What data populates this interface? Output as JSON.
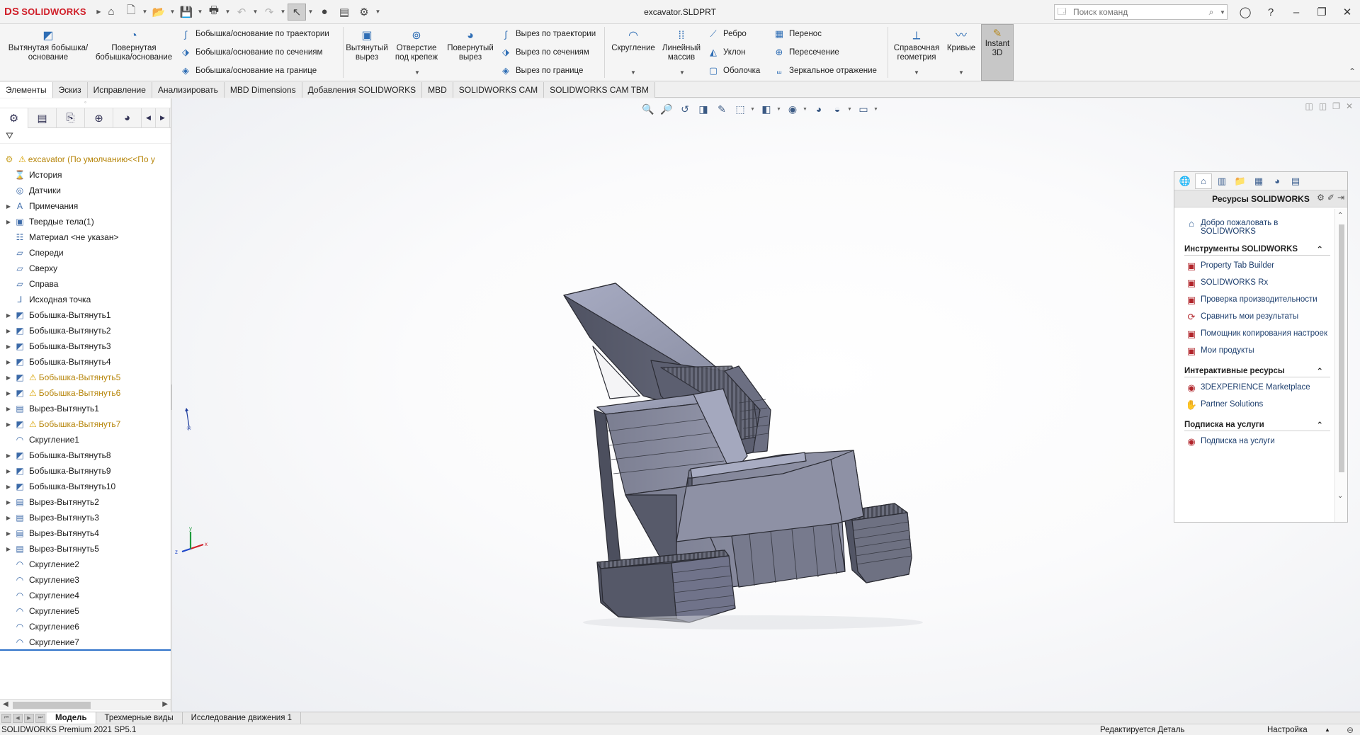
{
  "app": {
    "logo_brand": "SOLIDWORKS",
    "logo_mark": "DS",
    "doc_title": "excavator.SLDPRT"
  },
  "search": {
    "placeholder": "Поиск команд"
  },
  "ribbon": {
    "extrude_boss": "Вытянутая бобышка/основание",
    "revolve_boss": "Повернутая бобышка/основание",
    "sweep_boss": "Бобышка/основание по траектории",
    "loft_boss": "Бобышка/основание по сечениям",
    "boundary_boss": "Бобышка/основание на границе",
    "extrude_cut": "Вытянутый вырез",
    "hole_wizard": "Отверстие под крепеж",
    "revolve_cut": "Повернутый вырез",
    "sweep_cut": "Вырез по траектории",
    "loft_cut": "Вырез по сечениям",
    "boundary_cut": "Вырез по границе",
    "fillet": "Скругление",
    "linear_pattern": "Линейный массив",
    "rib": "Ребро",
    "draft": "Уклон",
    "shell": "Оболочка",
    "wrap": "Перенос",
    "intersect": "Пересечение",
    "mirror": "Зеркальное отражение",
    "ref_geometry": "Справочная геометрия",
    "curves": "Кривые",
    "instant3d": "Instant 3D"
  },
  "tabs": [
    "Элементы",
    "Эскиз",
    "Исправление",
    "Анализировать",
    "MBD Dimensions",
    "Добавления SOLIDWORKS",
    "MBD",
    "SOLIDWORKS CAM",
    "SOLIDWORKS CAM TBM"
  ],
  "tree": {
    "root": "excavator  (По умолчанию<<По у",
    "items": [
      {
        "label": "История",
        "icon": "history-icon",
        "exp": false,
        "warn": false
      },
      {
        "label": "Датчики",
        "icon": "sensor-icon",
        "exp": false,
        "warn": false
      },
      {
        "label": "Примечания",
        "icon": "annotation-icon",
        "exp": true,
        "warn": false
      },
      {
        "label": "Твердые тела(1)",
        "icon": "solid-bodies-icon",
        "exp": true,
        "warn": false
      },
      {
        "label": "Материал <не указан>",
        "icon": "material-icon",
        "exp": false,
        "warn": false
      },
      {
        "label": "Спереди",
        "icon": "plane-icon",
        "exp": false,
        "warn": false
      },
      {
        "label": "Сверху",
        "icon": "plane-icon",
        "exp": false,
        "warn": false
      },
      {
        "label": "Справа",
        "icon": "plane-icon",
        "exp": false,
        "warn": false
      },
      {
        "label": "Исходная точка",
        "icon": "origin-icon",
        "exp": false,
        "warn": false
      },
      {
        "label": "Бобышка-Вытянуть1",
        "icon": "extrude-icon",
        "exp": true,
        "warn": false
      },
      {
        "label": "Бобышка-Вытянуть2",
        "icon": "extrude-icon",
        "exp": true,
        "warn": false
      },
      {
        "label": "Бобышка-Вытянуть3",
        "icon": "extrude-icon",
        "exp": true,
        "warn": false
      },
      {
        "label": "Бобышка-Вытянуть4",
        "icon": "extrude-icon",
        "exp": true,
        "warn": false
      },
      {
        "label": "Бобышка-Вытянуть5",
        "icon": "extrude-icon",
        "exp": true,
        "warn": true
      },
      {
        "label": "Бобышка-Вытянуть6",
        "icon": "extrude-icon",
        "exp": true,
        "warn": true
      },
      {
        "label": "Вырез-Вытянуть1",
        "icon": "cut-icon",
        "exp": true,
        "warn": false
      },
      {
        "label": "Бобышка-Вытянуть7",
        "icon": "extrude-icon",
        "exp": true,
        "warn": true
      },
      {
        "label": "Скругление1",
        "icon": "fillet-icon",
        "exp": false,
        "warn": false
      },
      {
        "label": "Бобышка-Вытянуть8",
        "icon": "extrude-icon",
        "exp": true,
        "warn": false
      },
      {
        "label": "Бобышка-Вытянуть9",
        "icon": "extrude-icon",
        "exp": true,
        "warn": false
      },
      {
        "label": "Бобышка-Вытянуть10",
        "icon": "extrude-icon",
        "exp": true,
        "warn": false
      },
      {
        "label": "Вырез-Вытянуть2",
        "icon": "cut-icon",
        "exp": true,
        "warn": false
      },
      {
        "label": "Вырез-Вытянуть3",
        "icon": "cut-icon",
        "exp": true,
        "warn": false
      },
      {
        "label": "Вырез-Вытянуть4",
        "icon": "cut-icon",
        "exp": true,
        "warn": false
      },
      {
        "label": "Вырез-Вытянуть5",
        "icon": "cut-icon",
        "exp": true,
        "warn": false
      },
      {
        "label": "Скругление2",
        "icon": "fillet-icon",
        "exp": false,
        "warn": false
      },
      {
        "label": "Скругление3",
        "icon": "fillet-icon",
        "exp": false,
        "warn": false
      },
      {
        "label": "Скругление4",
        "icon": "fillet-icon",
        "exp": false,
        "warn": false
      },
      {
        "label": "Скругление5",
        "icon": "fillet-icon",
        "exp": false,
        "warn": false
      },
      {
        "label": "Скругление6",
        "icon": "fillet-icon",
        "exp": false,
        "warn": false
      },
      {
        "label": "Скругление7",
        "icon": "fillet-icon",
        "exp": false,
        "warn": false
      }
    ]
  },
  "taskpane": {
    "title": "Ресурсы SOLIDWORKS",
    "welcome": "Добро пожаловать в SOLIDWORKS",
    "tools_header": "Инструменты SOLIDWORKS",
    "tools": [
      "Property Tab Builder",
      "SOLIDWORKS Rx",
      "Проверка производительности",
      "Сравнить мои результаты",
      "Помощник копирования настроек",
      "Мои продукты"
    ],
    "online_header": "Интерактивные ресурсы",
    "online": [
      "3DEXPERIENCE Marketplace",
      "Partner Solutions"
    ],
    "subs_header": "Подписка на услуги",
    "subs": [
      "Подписка на услуги"
    ]
  },
  "axes": {
    "x": "x",
    "y": "y",
    "z": "z"
  },
  "bottom_tabs": [
    "Модель",
    "Трехмерные виды",
    "Исследование движения 1"
  ],
  "status": {
    "version": "SOLIDWORKS Premium 2021 SP5.1",
    "editing": "Редактируется Деталь",
    "settings": "Настройка"
  },
  "colors": {
    "accent": "#d0202a",
    "model_face": "#6b6e80",
    "model_edge": "#2a2b33",
    "selection_blue": "#2f72c9"
  }
}
